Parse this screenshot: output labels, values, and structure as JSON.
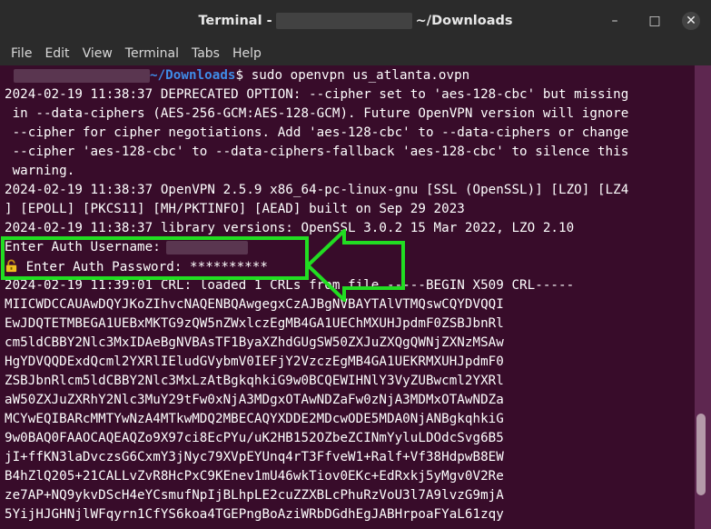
{
  "window": {
    "title_prefix": "Terminal -",
    "title_suffix": "~/Downloads",
    "minimize_icon": "–",
    "maximize_icon": "□",
    "close_icon": "✕"
  },
  "menu": [
    "File",
    "Edit",
    "View",
    "Terminal",
    "Tabs",
    "Help"
  ],
  "terminal": {
    "prompt_path": "~/Downloads",
    "command": "$ sudo openvpn us_atlanta.ovpn",
    "lines": [
      "2024-02-19 11:38:37 DEPRECATED OPTION: --cipher set to 'aes-128-cbc' but missing",
      " in --data-ciphers (AES-256-GCM:AES-128-GCM). Future OpenVPN version will ignore",
      " --cipher for cipher negotiations. Add 'aes-128-cbc' to --data-ciphers or change",
      " --cipher 'aes-128-cbc' to --data-ciphers-fallback 'aes-128-cbc' to silence this",
      " warning.",
      "2024-02-19 11:38:37 OpenVPN 2.5.9 x86_64-pc-linux-gnu [SSL (OpenSSL)] [LZO] [LZ4",
      "] [EPOLL] [PKCS11] [MH/PKTINFO] [AEAD] built on Sep 29 2023",
      "2024-02-19 11:38:37 library versions: OpenSSL 3.0.2 15 Mar 2022, LZO 2.10"
    ],
    "auth_username_label": "Enter Auth Username:",
    "auth_password_label": " Enter Auth Password: **********",
    "crl_line": "2024-02-19 11:39:01 CRL: loaded 1 CRLs from file -----BEGIN X509 CRL-----",
    "cert_lines": [
      "MIICWDCCAUAwDQYJKoZIhvcNAQENBQAwgegxCzAJBgNVBAYTAlVTMQswCQYDVQQI",
      "EwJDQTETMBEGA1UEBxMKTG9zQW5nZWxlczEgMB4GA1UEChMXUHJpdmF0ZSBJbnRl",
      "cm5ldCBBY2Nlc3MxIDAeBgNVBAsTF1ByaXZhdGUgSW50ZXJuZXQgQWNjZXNzMSAw",
      "HgYDVQQDExdQcml2YXRlIEludGVybmV0IEFjY2VzczEgMB4GA1UEKRMXUHJpdmF0",
      "ZSBJbnRlcm5ldCBBY2Nlc3MxLzAtBgkqhkiG9w0BCQEWIHNlY3VyZUBwcml2YXRl",
      "aW50ZXJuZXRhY2Nlc3MuY29tFw0xNjA3MDgxOTAwNDZaFw0zNjA3MDMxOTAwNDZa",
      "MCYwEQIBARcMMTYwNzA4MTkwMDQ2MBECAQYXDDE2MDcwODE5MDA0NjANBgkqhkiG",
      "9w0BAQ0FAAOCAQEAQZo9X97ci8EcPYu/uK2HB152OZbeZCINmYyluLDOdcSvg6B5",
      "jI+ffKN3laDvczsG6CxmY3jNyc79XVpEYUnq4rT3FfveW1+Ralf+Vf38HdpwB8EW",
      "B4hZlQ205+21CALLvZvR8HcPxC9KEnev1mU46wkTiov0EKc+EdRxkj5yMgv0V2Re",
      "ze7AP+NQ9ykvDScH4eYCsmufNpIjBLhpLE2cuZZXBLcPhuRzVoU3l7A9lvzG9mjA",
      "5YijHJGHNjlWFqyrn1CfYS6koa4TGEPngBoAziWRbDGdhEgJABHrpoaFYaL61zqy"
    ]
  }
}
